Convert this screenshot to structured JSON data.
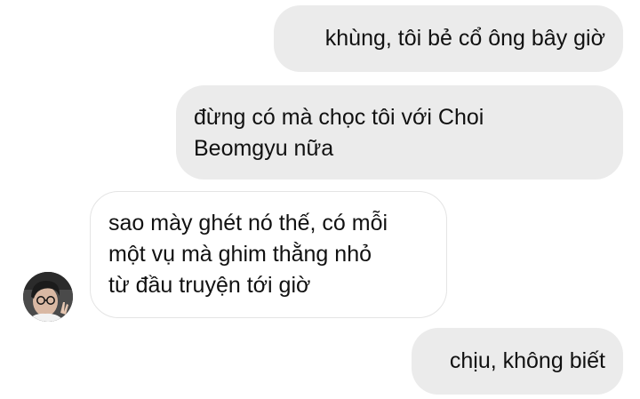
{
  "messages": [
    {
      "direction": "outgoing",
      "text": "khùng, tôi bẻ cổ ông bây giờ"
    },
    {
      "direction": "outgoing",
      "text": "đừng có mà chọc tôi với Choi\nBeomgyu nữa"
    },
    {
      "direction": "incoming",
      "text": "sao mày ghét nó thế, có mỗi\nmột vụ mà ghim thằng nhỏ\ntừ đầu truyện tới giờ"
    },
    {
      "direction": "outgoing",
      "text": "chịu, không biết"
    }
  ],
  "colors": {
    "outgoing_bubble": "#ebebeb",
    "incoming_bubble_border": "#e4e4e4",
    "text": "#111111",
    "background": "#ffffff"
  },
  "icons": {
    "avatar": "contact-avatar-photo"
  }
}
